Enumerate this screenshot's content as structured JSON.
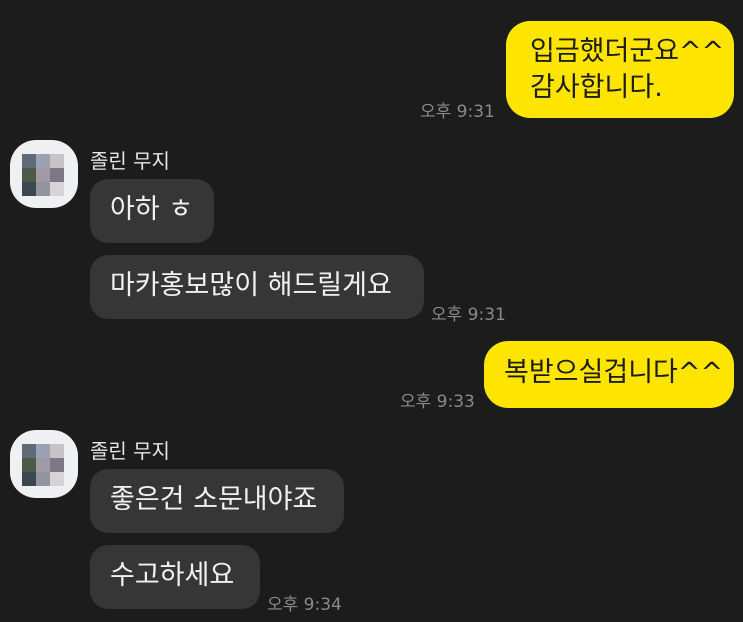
{
  "messages": [
    {
      "sender": "me",
      "lines": [
        "입금했더군요^^",
        "감사합니다."
      ],
      "time": "오후 9:31"
    },
    {
      "sender": "other",
      "name": "졸린 무지",
      "text": "아하 ㅎ"
    },
    {
      "sender": "other",
      "text": "마카홍보많이 해드릴게요",
      "time": "오후 9:31"
    },
    {
      "sender": "me",
      "text": "복받으실겁니다^^",
      "time": "오후 9:33"
    },
    {
      "sender": "other",
      "name": "졸린 무지",
      "text": "좋은건 소문내야죠"
    },
    {
      "sender": "other",
      "text": "수고하세요",
      "time": "오후 9:34"
    }
  ],
  "colors": {
    "background": "#1c1c1c",
    "my_bubble": "#fee500",
    "their_bubble": "#363636"
  },
  "avatar_icon": "blurred-profile-avatar"
}
